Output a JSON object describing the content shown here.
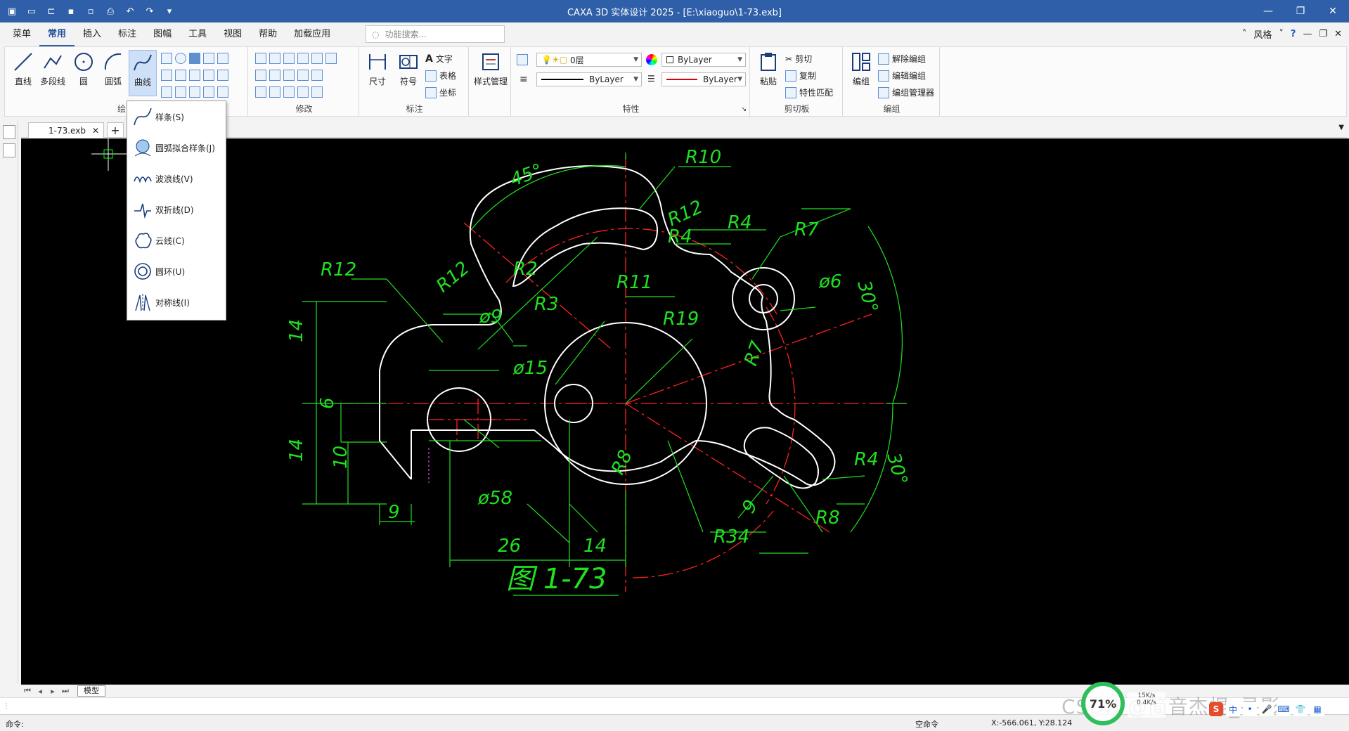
{
  "window": {
    "title": "CAXA 3D 实体设计 2025 - [E:\\xiaoguo\\1-73.exb]"
  },
  "menu": {
    "tabs": [
      "菜单",
      "常用",
      "插入",
      "标注",
      "图幅",
      "工具",
      "视图",
      "帮助",
      "加载应用"
    ],
    "active_index": 1,
    "search_placeholder": "功能搜索...",
    "style_label": "风格"
  },
  "ribbon": {
    "draw": {
      "buttons": [
        "直线",
        "多段线",
        "圆",
        "圆弧",
        "曲线"
      ],
      "group_label": "绘"
    },
    "modify": {
      "group_label": "修改"
    },
    "annotate": {
      "buttons": [
        "尺寸",
        "符号"
      ],
      "small": [
        "文字",
        "表格",
        "坐标"
      ],
      "group_label": "标注"
    },
    "style": {
      "button": "样式管理"
    },
    "properties": {
      "layer": "0层",
      "color": "ByLayer",
      "linetype": "ByLayer",
      "lineweight": "ByLayer",
      "group_label": "特性"
    },
    "clipboard": {
      "paste": "粘贴",
      "small": [
        "剪切",
        "复制",
        "特性匹配"
      ],
      "group_label": "剪切板"
    },
    "edit_group": {
      "button": "编组",
      "small": [
        "解除编组",
        "编辑编组",
        "编组管理器"
      ],
      "group_label": "编组"
    }
  },
  "curve_menu": {
    "items": [
      "样条(S)",
      "圆弧拟合样条(J)",
      "波浪线(V)",
      "双折线(D)",
      "云线(C)",
      "圆环(U)",
      "对称线(I)"
    ]
  },
  "document": {
    "tab": "1-73.exb",
    "layout_tab": "模型"
  },
  "drawing": {
    "title": "图 1-73",
    "dimensions": [
      "45°",
      "R10",
      "R12",
      "R12",
      "R4",
      "R4",
      "R7",
      "R12",
      "R2",
      "R3",
      "R11",
      "ø9",
      "ø6",
      "30°",
      "R19",
      "14",
      "6",
      "ø15",
      "R7",
      "14",
      "10",
      "R8",
      "R4",
      "30°",
      "9",
      "ø58",
      "9",
      "R8",
      "26",
      "14",
      "R34"
    ],
    "colors": {
      "outline": "#ffffff",
      "center": "#ff2020",
      "dimension": "#20e020",
      "background": "#000000"
    }
  },
  "status": {
    "command_prompt": "命令:",
    "command_state": "空命令",
    "coordinates": "X:-566.061, Y:28.124",
    "zoom_percent": "71%",
    "net_up": "15K/s",
    "net_down": "0.4K/s",
    "watermark": "CSDN @简音杰棍_寻影"
  }
}
